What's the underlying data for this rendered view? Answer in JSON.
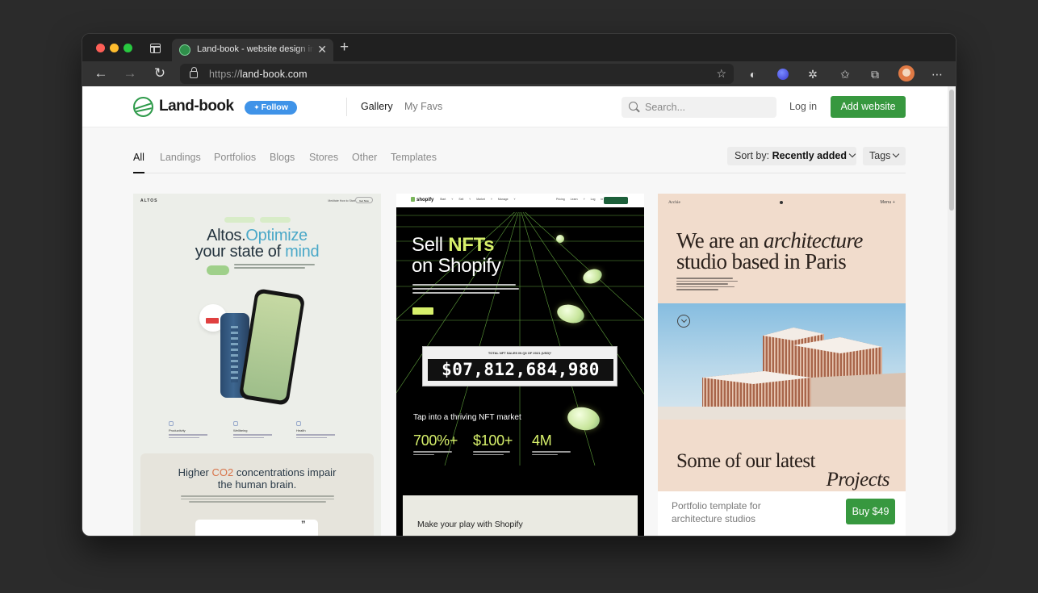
{
  "browser": {
    "tab": {
      "title": "Land-book - website design inspiration"
    },
    "url": {
      "protocol": "https://",
      "host": "land-book.com"
    }
  },
  "site": {
    "logo": "Land-book",
    "follow_label": "Follow",
    "nav": {
      "gallery": "Gallery",
      "favs": "My Favs"
    },
    "search_placeholder": "Search...",
    "login": "Log in",
    "add_website": "Add website",
    "accent_color": "#37983f"
  },
  "filters": {
    "categories": [
      "All",
      "Landings",
      "Portfolios",
      "Blogs",
      "Stores",
      "Other",
      "Templates"
    ],
    "active": "All",
    "sort_prefix": "Sort by:",
    "sort_value": "Recently added",
    "tags": "Tags"
  },
  "cards": [
    {
      "site": "altos",
      "nav_logo": "ALTOS",
      "nav_links": "Meditate   How to Start",
      "nav_button": "Get Now",
      "headline_a": "Altos.",
      "headline_b": "Optimize",
      "headline_c": "your state of ",
      "headline_d": "mind",
      "features": [
        "Productivity",
        "Wellbeing",
        "Health"
      ],
      "section_title_a": "Higher ",
      "section_title_b": "CO2",
      "section_title_c": " concentrations impair",
      "section_title_d": "the human brain.",
      "quote_mark": "”"
    },
    {
      "site": "shopify",
      "nav_logo": "shopify",
      "nav_links": "Start ˅  Sell ˅  Market ˅  Manage ˅",
      "nav_right_links": "Pricing  Learn ˅  Log in",
      "headline_a": "Sell ",
      "headline_b": "NFTs",
      "headline_c": "on Shopify",
      "counter_label": "TOTAL NFT SALES IN Q3 OF 2021 (USD)*",
      "counter_value": "$07,812,684,980",
      "market_title": "Tap into a thriving NFT market",
      "stats": [
        "700%+",
        "$100+",
        "4M"
      ],
      "bottom_text": "Make your play with Shopify"
    },
    {
      "site": "archie",
      "nav_logo": "Archie",
      "nav_menu": "Menu +",
      "headline_a": "We are an ",
      "headline_b": "architecture",
      "headline_c": "studio based in Paris",
      "latest": "Some of our latest",
      "projects": "Projects",
      "caption": "Portfolio template for architecture studios",
      "buy_label": "Buy $49"
    }
  ]
}
